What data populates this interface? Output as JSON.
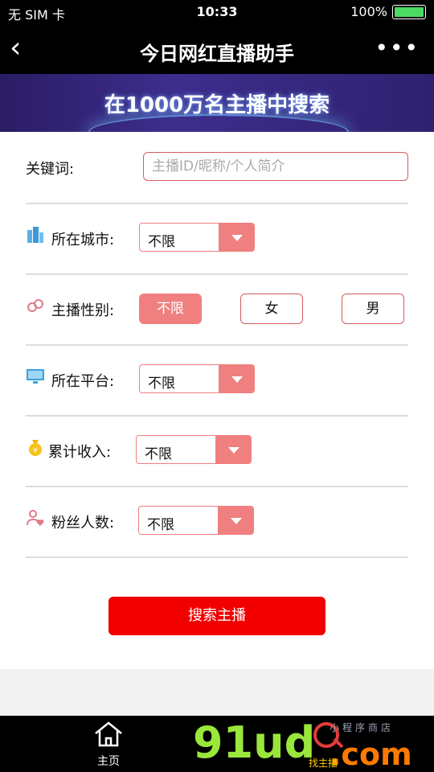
{
  "status_bar": {
    "carrier": "无 SIM 卡",
    "time": "10:33",
    "battery": "100%"
  },
  "nav": {
    "title": "今日网红直播助手",
    "back_icon": "back-chevron-icon",
    "more_icon": "more-dots-icon"
  },
  "banner": {
    "text": "在1000万名主播中搜索"
  },
  "form": {
    "keyword": {
      "label": "关键词:",
      "placeholder": "主播ID/昵称/个人简介"
    },
    "city": {
      "label": "所在城市:",
      "value": "不限",
      "icon": "building-icon"
    },
    "gender": {
      "label": "主播性别:",
      "icon": "gender-icon",
      "options": [
        "不限",
        "女",
        "男"
      ],
      "selected": "不限"
    },
    "platform": {
      "label": "所在平台:",
      "value": "不限",
      "icon": "monitor-icon"
    },
    "income": {
      "label": "累计收入:",
      "value": "不限",
      "icon": "money-bag-icon"
    },
    "fans": {
      "label": "粉丝人数:",
      "value": "不限",
      "icon": "fans-heart-icon"
    },
    "submit_label": "搜索主播"
  },
  "tabbar": {
    "home_label": "主页",
    "home_icon": "home-icon"
  },
  "watermark": {
    "brand": "91ud",
    "domain": ".com",
    "slogan": "小程序商店",
    "tag": "找主播"
  },
  "colors": {
    "accent": "#f07f7f",
    "primary_button": "#f20000",
    "background": "#f2f2f2"
  }
}
